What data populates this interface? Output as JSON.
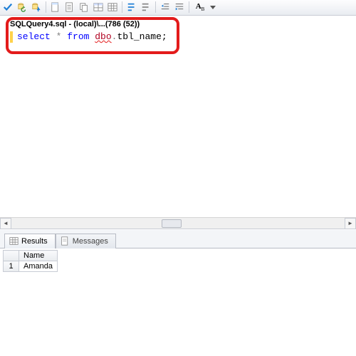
{
  "toolbar": {
    "buttons": [
      {
        "name": "execute-check-icon"
      },
      {
        "name": "db-refresh-icon"
      },
      {
        "name": "db-change-icon"
      },
      {
        "name": "sep"
      },
      {
        "name": "page-icon"
      },
      {
        "name": "page-script-icon"
      },
      {
        "name": "copy-icon"
      },
      {
        "name": "table-icon"
      },
      {
        "name": "grid-icon"
      },
      {
        "name": "sep"
      },
      {
        "name": "comment-icon"
      },
      {
        "name": "uncomment-icon"
      },
      {
        "name": "sep"
      },
      {
        "name": "indent-left-icon"
      },
      {
        "name": "indent-right-icon"
      },
      {
        "name": "sep"
      },
      {
        "name": "font-size-icon"
      },
      {
        "name": "dropdown-icon"
      }
    ]
  },
  "editor": {
    "filename": "SQLQuery4.sql - (local)\\...(786 (52))",
    "sql": {
      "kw_select": "select",
      "star": " * ",
      "kw_from": "from",
      "space": " ",
      "schema": "dbo",
      "dot": ".",
      "table": "tbl_name",
      "semi": ";"
    }
  },
  "results": {
    "tabs": [
      {
        "label": "Results",
        "active": true
      },
      {
        "label": "Messages",
        "active": false
      }
    ],
    "columns": [
      "Name"
    ],
    "rows": [
      {
        "num": "1",
        "cells": [
          "Amanda"
        ]
      }
    ]
  }
}
